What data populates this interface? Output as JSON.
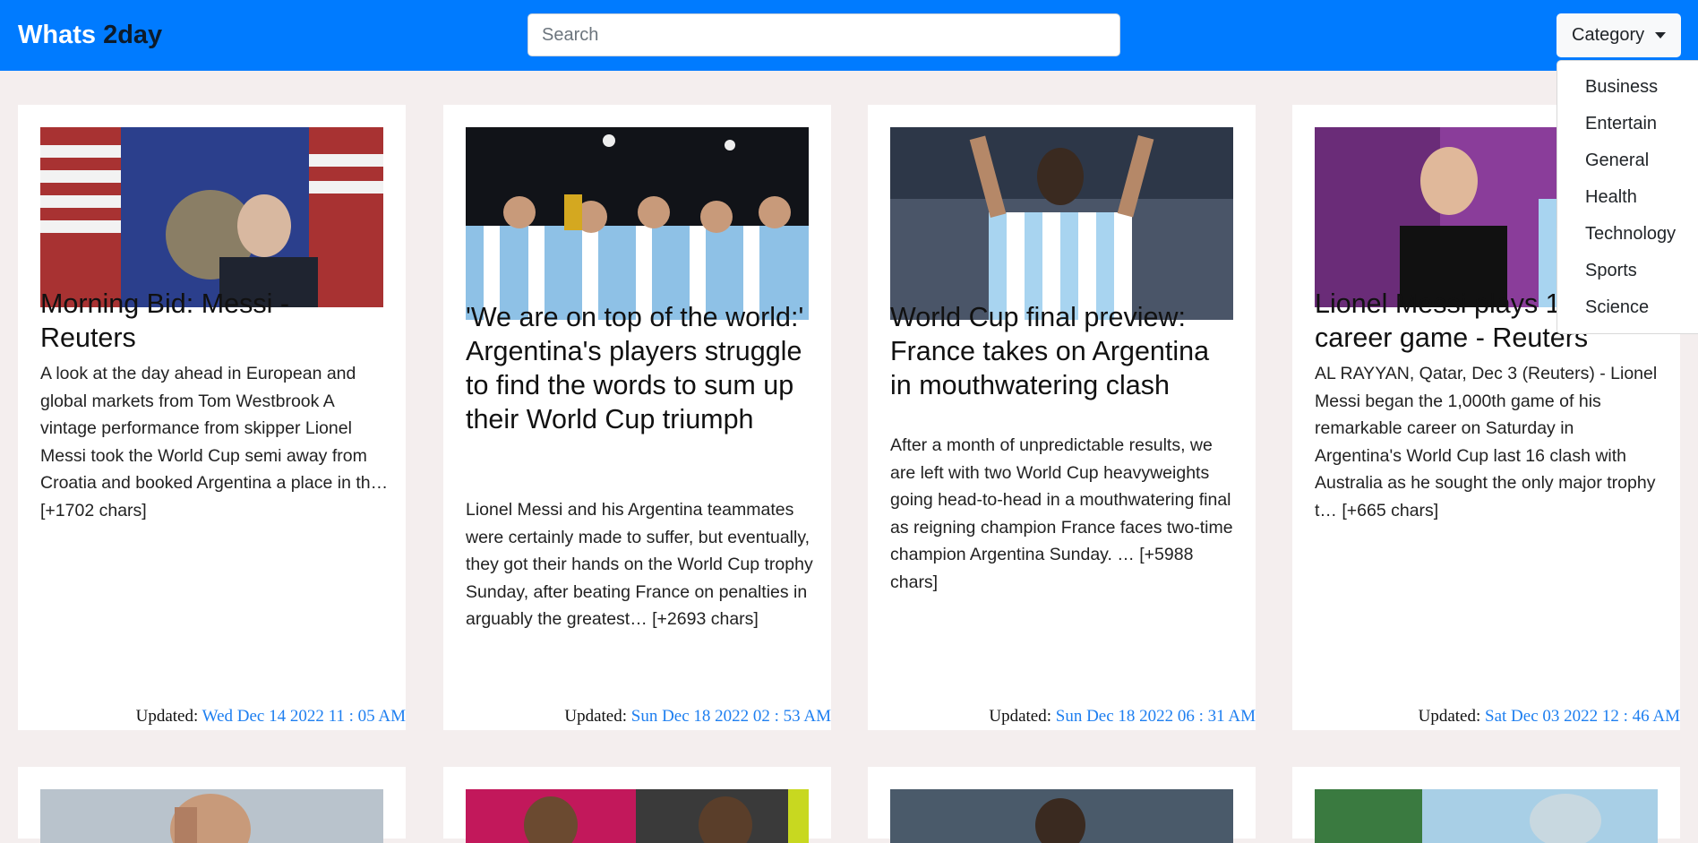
{
  "brand": {
    "part1": "Whats",
    "part2": "2day"
  },
  "search": {
    "placeholder": "Search"
  },
  "category": {
    "label": "Category",
    "items": [
      "Business",
      "Entertain",
      "General",
      "Health",
      "Technology",
      "Sports",
      "Science"
    ]
  },
  "updated_label": "Updated:",
  "articles": [
    {
      "title": "Morning Bid: Messi - Reuters",
      "description": "A look at the day ahead in European and global markets from Tom Westbrook A vintage performance from skipper Lionel Messi took the World Cup semi away from Croatia and booked Argentina a place in th… [+1702 chars]",
      "updated": "Wed Dec 14 2022 11 : 05 AM"
    },
    {
      "title": "'We are on top of the world:' Argentina's players struggle to find the words to sum up their World Cup triumph",
      "description": "Lionel Messi and his Argentina teammates were certainly made to suffer, but eventually, they got their hands on the World Cup trophy Sunday, after beating France on penalties in arguably the greatest… [+2693 chars]",
      "updated": "Sun Dec 18 2022 02 : 53 AM"
    },
    {
      "title": "World Cup final preview: France takes on Argentina in mouthwatering clash",
      "description": "After a month of unpredictable results, we are left with two World Cup heavyweights going head-to-head in a mouthwatering final as reigning champion France faces two-time champion Argentina Sunday. … [+5988 chars]",
      "updated": "Sun Dec 18 2022 06 : 31 AM"
    },
    {
      "title": "Lionel Messi plays 1000th career game - Reuters",
      "description": "AL RAYYAN, Qatar, Dec 3 (Reuters) - Lionel Messi began the 1,000th game of his remarkable career on Saturday in Argentina's World Cup last 16 clash with Australia as he sought the only major trophy t… [+665 chars]",
      "updated": "Sat Dec 03 2022 12 : 46 AM"
    }
  ],
  "colors": {
    "navbar": "#007bff",
    "page_background": "#f4eeee",
    "date_text": "#1e7ff0"
  }
}
